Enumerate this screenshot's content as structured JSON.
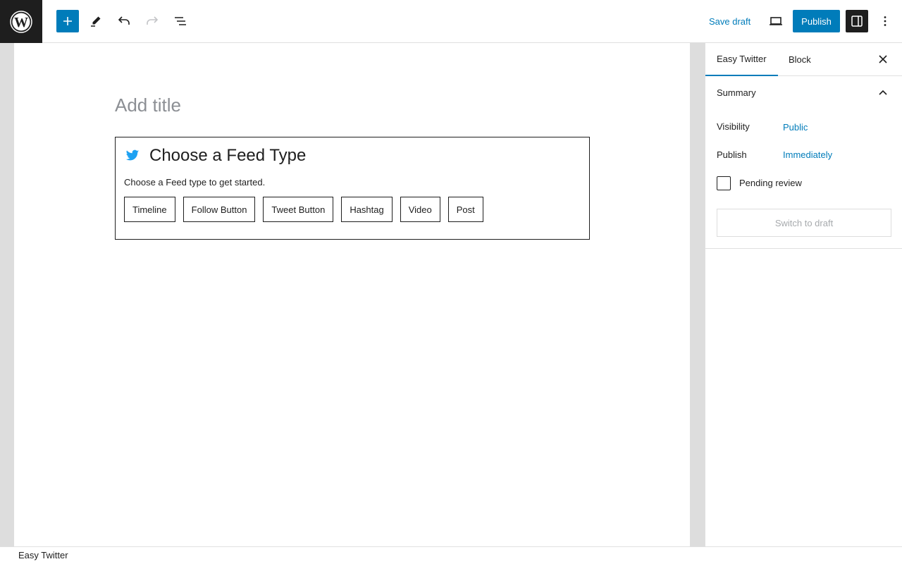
{
  "toolbar": {
    "logo_icon": "wordpress-logo",
    "add_icon": "plus-icon",
    "edit_icon": "pencil-icon",
    "undo_icon": "undo-icon",
    "redo_icon": "redo-icon",
    "outline_icon": "list-view-icon",
    "save_draft_label": "Save draft",
    "preview_icon": "desktop-preview-icon",
    "publish_label": "Publish",
    "settings_icon": "sidebar-settings-icon",
    "more_icon": "more-vertical-icon",
    "accent_color": "#007cba"
  },
  "editor": {
    "title_placeholder": "Add title",
    "block": {
      "icon": "twitter-bird-icon",
      "icon_color": "#1da1f2",
      "title": "Choose a Feed Type",
      "description": "Choose a Feed type to get started.",
      "feed_types": [
        "Timeline",
        "Follow Button",
        "Tweet Button",
        "Hashtag",
        "Video",
        "Post"
      ]
    }
  },
  "sidebar": {
    "tabs": [
      {
        "label": "Easy Twitter",
        "active": true
      },
      {
        "label": "Block",
        "active": false
      }
    ],
    "close_icon": "close-icon",
    "summary": {
      "title": "Summary",
      "toggle_icon": "chevron-up-icon",
      "visibility_label": "Visibility",
      "visibility_value": "Public",
      "publish_label": "Publish",
      "publish_value": "Immediately",
      "pending_review_label": "Pending review",
      "pending_review_checked": false,
      "switch_to_draft_label": "Switch to draft"
    }
  },
  "footer": {
    "breadcrumb": "Easy Twitter"
  }
}
